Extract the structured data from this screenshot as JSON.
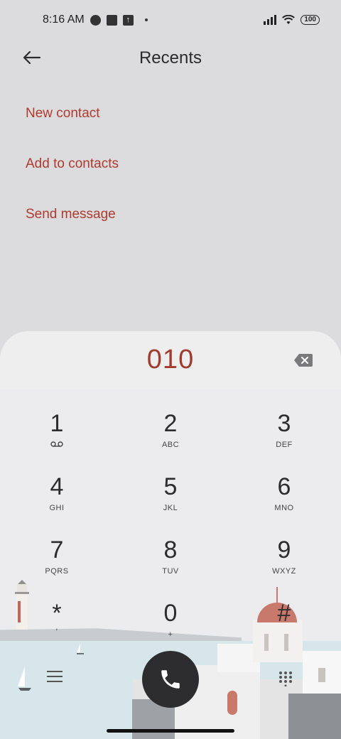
{
  "status_bar": {
    "time": "8:16 AM",
    "battery": "100",
    "icons": [
      "app-icon",
      "square-icon",
      "upload-icon",
      "dot-icon",
      "signal-icon",
      "wifi-icon",
      "battery-icon"
    ]
  },
  "header": {
    "title": "Recents",
    "back_icon": "back-arrow-icon"
  },
  "menu": {
    "items": [
      {
        "label": "New contact"
      },
      {
        "label": "Add to contacts"
      },
      {
        "label": "Send message"
      }
    ]
  },
  "dialer": {
    "number": "010",
    "keys": [
      {
        "digit": "1",
        "letters": ""
      },
      {
        "digit": "2",
        "letters": "ABC"
      },
      {
        "digit": "3",
        "letters": "DEF"
      },
      {
        "digit": "4",
        "letters": "GHI"
      },
      {
        "digit": "5",
        "letters": "JKL"
      },
      {
        "digit": "6",
        "letters": "MNO"
      },
      {
        "digit": "7",
        "letters": "PQRS"
      },
      {
        "digit": "8",
        "letters": "TUV"
      },
      {
        "digit": "9",
        "letters": "WXYZ"
      },
      {
        "digit": "*",
        "letters": ","
      },
      {
        "digit": "0",
        "letters": "+"
      },
      {
        "digit": "#",
        "letters": ""
      }
    ]
  },
  "colors": {
    "accent": "#b03a2e",
    "background": "#dcdcde",
    "call_button": "#2d2d2f"
  }
}
